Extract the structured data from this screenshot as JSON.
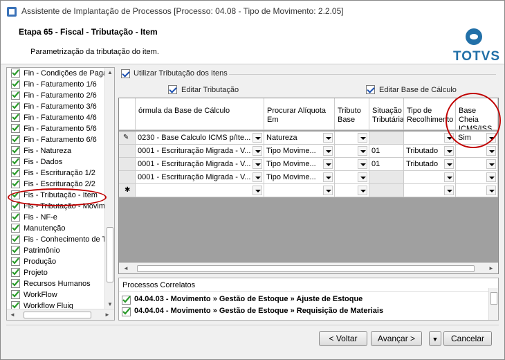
{
  "window": {
    "title": "Assistente de Implantação de Processos [Processo: 04.08 - Tipo de Movimento: 2.2.05]"
  },
  "header": {
    "stage": "Etapa 65 - Fiscal - Tributação - Item",
    "description": "Parametrização da tributação do item.",
    "logo_text": "TOTVS"
  },
  "sidebar": {
    "items": [
      {
        "label": "Fin - Condições de Paga"
      },
      {
        "label": "Fin - Faturamento 1/6"
      },
      {
        "label": "Fin - Faturamento 2/6"
      },
      {
        "label": "Fin - Faturamento 3/6"
      },
      {
        "label": "Fin - Faturamento 4/6"
      },
      {
        "label": "Fin - Faturamento 5/6"
      },
      {
        "label": "Fin - Faturamento 6/6"
      },
      {
        "label": "Fis - Natureza"
      },
      {
        "label": "Fis - Dados"
      },
      {
        "label": "Fis - Escrituração 1/2"
      },
      {
        "label": "Fis - Escrituração 2/2"
      },
      {
        "label": "Fis - Tributação - Item"
      },
      {
        "label": "Fis - Tributação - Movime"
      },
      {
        "label": "Fis - NF-e"
      },
      {
        "label": "Manutenção"
      },
      {
        "label": "Fis - Conhecimento de T"
      },
      {
        "label": "Patrimônio"
      },
      {
        "label": "Produção"
      },
      {
        "label": "Projeto"
      },
      {
        "label": "Recursos Humanos"
      },
      {
        "label": "WorkFlow"
      },
      {
        "label": "Workflow Fluig"
      }
    ]
  },
  "options": {
    "use_item_taxation": "Utilizar Tributação dos Itens",
    "edit_taxation": "Editar Tributação",
    "edit_base": "Editar Base de Cálculo"
  },
  "grid": {
    "headers": [
      "órmula da Base de Cálculo",
      "Procurar Alíquota Em",
      "Tributo Base",
      "Situação Tributária",
      "Tipo de Recolhimento",
      "Base Cheia ICMS/ISS"
    ],
    "rows": [
      [
        "0230 - Base Calculo ICMS p/Ite...",
        "Natureza",
        "",
        "",
        "",
        "Sim"
      ],
      [
        "0001 - Escrituração Migrada - V...",
        "Tipo Movime...",
        "",
        "01",
        "Tributado",
        ""
      ],
      [
        "0001 - Escrituração Migrada - V...",
        "Tipo Movime...",
        "",
        "01",
        "Tributado",
        ""
      ],
      [
        "0001 - Escrituração Migrada - V...",
        "Tipo Movime...",
        "",
        "",
        "",
        ""
      ]
    ]
  },
  "processes": {
    "title": "Processos Correlatos",
    "items": [
      "04.04.03 - Movimento » Gestão de Estoque » Ajuste de Estoque",
      "04.04.04 - Movimento » Gestão de Estoque » Requisição de Materiais"
    ]
  },
  "buttons": {
    "back": "< Voltar",
    "next": "Avançar >",
    "cancel": "Cancelar"
  },
  "colors": {
    "accent": "#2270a8",
    "highlight": "#c00000",
    "check": "#2a9a2a"
  }
}
